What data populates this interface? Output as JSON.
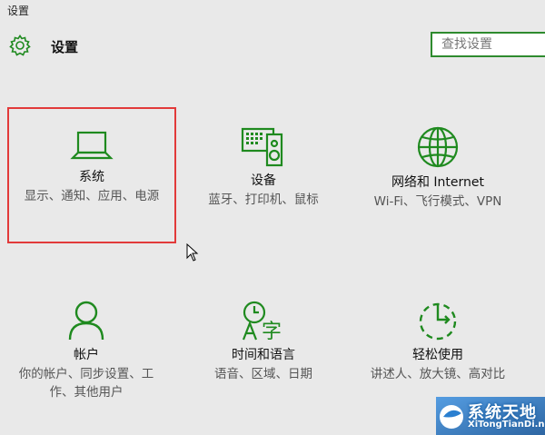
{
  "window": {
    "title": "设置"
  },
  "header": {
    "title": "设置",
    "icon": "gear-icon"
  },
  "search": {
    "placeholder": "查找设置"
  },
  "accent_color": "#1f8a1f",
  "selection_color": "#e23a3a",
  "tiles": [
    {
      "name": "系统",
      "desc": "显示、通知、应用、电源",
      "icon": "laptop-icon",
      "selected": true
    },
    {
      "name": "设备",
      "desc": "蓝牙、打印机、鼠标",
      "icon": "devices-icon",
      "selected": false
    },
    {
      "name": "网络和 Internet",
      "desc": "Wi-Fi、飞行模式、VPN",
      "icon": "globe-icon",
      "selected": false
    },
    {
      "name": "帐户",
      "desc": "你的帐户、同步设置、工作、其他用户",
      "icon": "person-icon",
      "selected": false
    },
    {
      "name": "时间和语言",
      "desc": "语音、区域、日期",
      "icon": "time-language-icon",
      "selected": false
    },
    {
      "name": "轻松使用",
      "desc": "讲述人、放大镜、高对比",
      "icon": "ease-of-access-icon",
      "selected": false
    }
  ],
  "watermark": {
    "cn": "系统天地",
    "en": "XiTongTianDi.net"
  }
}
